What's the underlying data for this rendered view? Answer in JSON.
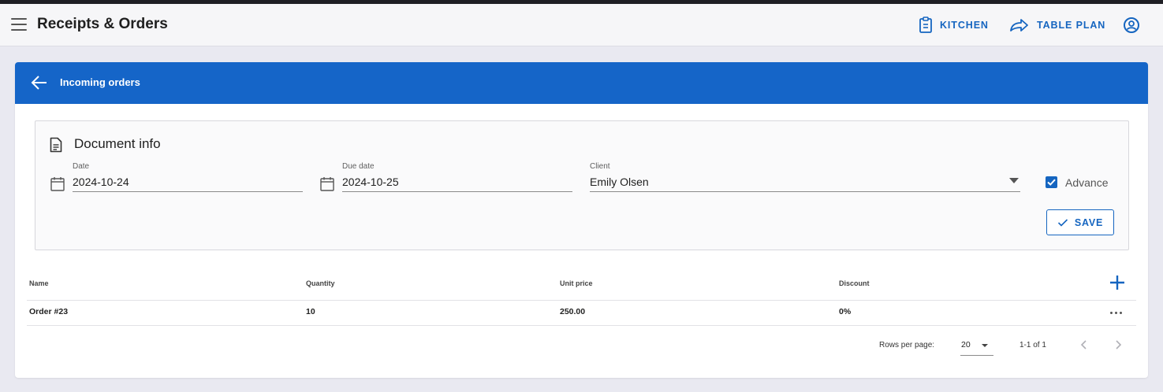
{
  "app": {
    "title": "Receipts & Orders",
    "kitchen_label": "KITCHEN",
    "table_plan_label": "TABLE PLAN",
    "accent_color": "#1565c0"
  },
  "header": {
    "title": "Incoming orders",
    "background_color": "#1565c8"
  },
  "document_info": {
    "title": "Document info",
    "date": {
      "label": "Date",
      "value": "2024-10-24"
    },
    "due_date": {
      "label": "Due date",
      "value": "2024-10-25"
    },
    "client": {
      "label": "Client",
      "value": "Emily Olsen"
    },
    "advance": {
      "label": "Advance",
      "checked": true
    },
    "save_label": "SAVE"
  },
  "table": {
    "columns": [
      "Name",
      "Quantity",
      "Unit price",
      "Discount"
    ],
    "rows": [
      {
        "name": "Order #23",
        "quantity": "10",
        "unit_price": "250.00",
        "discount": "0%"
      }
    ]
  },
  "pagination": {
    "rows_per_page_label": "Rows per page:",
    "rows_per_page": "20",
    "range": "1-1 of 1"
  },
  "icons": [
    "menu-icon",
    "clipboard-icon",
    "share-arrow-icon",
    "account-icon",
    "arrow-left-icon",
    "document-icon",
    "calendar-icon",
    "check-icon",
    "plus-icon",
    "more-horizontal-icon",
    "chevron-left-icon",
    "chevron-right-icon"
  ]
}
